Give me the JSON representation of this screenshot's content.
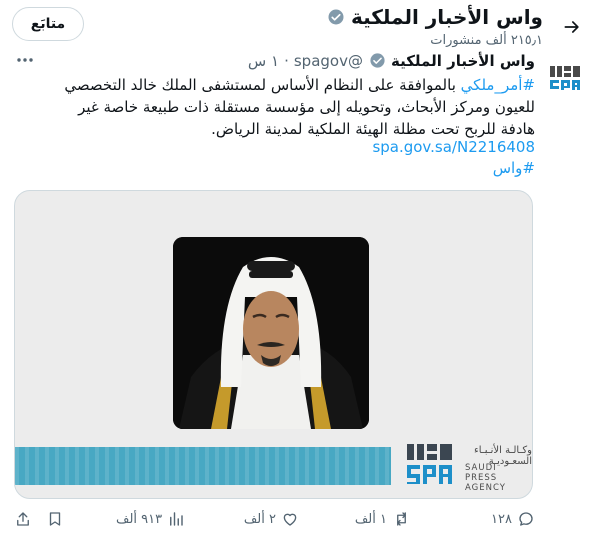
{
  "header": {
    "title": "واس الأخبار الملكية",
    "posts_count": "٢١٥٫١ ألف منشورات",
    "follow_label": "متابَع"
  },
  "tweet": {
    "author_name": "واس الأخبار الملكية",
    "handle": "@spagov",
    "separator": "·",
    "time": "١ س",
    "hashtag_royal": "#أمر_ملكي",
    "body": " بالموافقة على النظام الأساس لمستشفى الملك خالد التخصصي للعيون ومركز الأبحاث، وتحويله إلى مؤسسة مستقلة ذات طبيعة خاصة غير هادفة للربح تحت مظلة الهيئة الملكية لمدينة الرياض.",
    "link": "spa.gov.sa/N2216408",
    "hashtag_spa": "#واس"
  },
  "media": {
    "agency_ar": "وكـالـة الأنـبـاء السعـوديـة",
    "agency_en_1": "SAUDI PRESS",
    "agency_en_2": "AGENCY",
    "stripe_color": "#48a8c3"
  },
  "actions": {
    "replies": "١٢٨",
    "reposts": "١ ألف",
    "likes": "٢ ألف",
    "views": "٩١٣ ألف"
  },
  "colors": {
    "accent": "#1d9bf0",
    "verified_badge": "#829aab",
    "muted_text": "#536471"
  },
  "icons": [
    "back-arrow-icon",
    "verified-icon",
    "more-icon",
    "reply-icon",
    "repost-icon",
    "like-icon",
    "views-icon",
    "bookmark-icon",
    "share-icon"
  ]
}
